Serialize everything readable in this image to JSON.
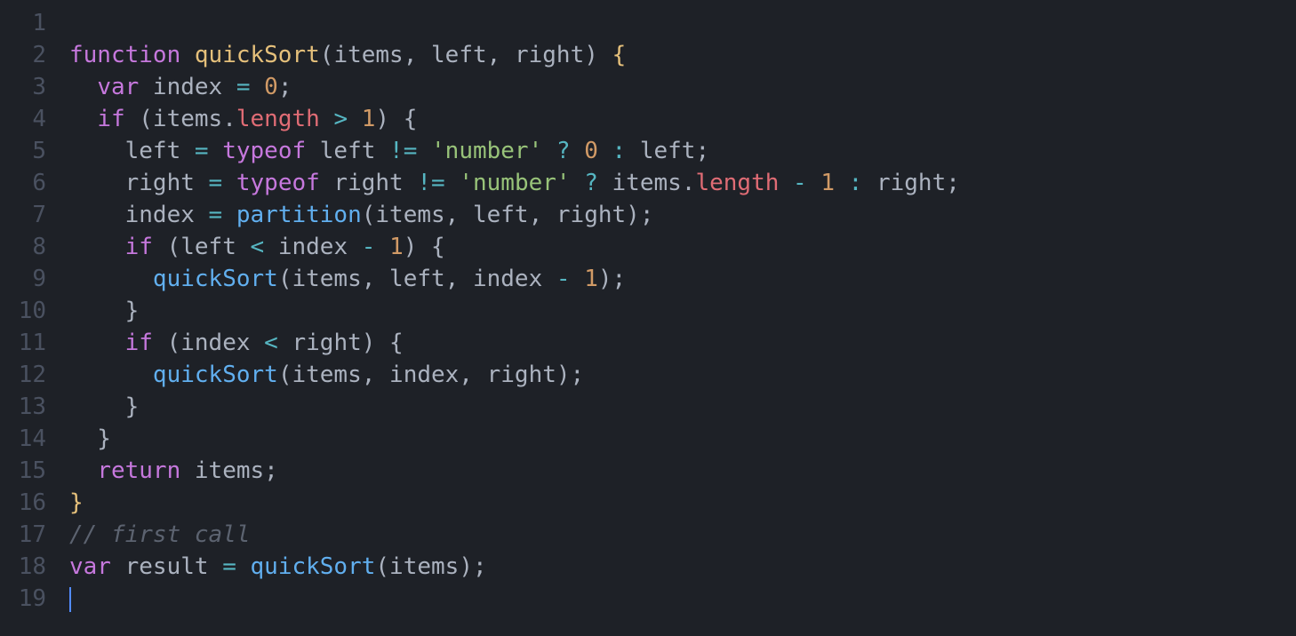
{
  "editor": {
    "language": "javascript",
    "lineNumbers": [
      "1",
      "2",
      "3",
      "4",
      "5",
      "6",
      "7",
      "8",
      "9",
      "10",
      "11",
      "12",
      "13",
      "14",
      "15",
      "16",
      "17",
      "18",
      "19"
    ],
    "cursor": {
      "line": 19,
      "column": 1
    },
    "lines": [
      {
        "tokens": []
      },
      {
        "tokens": [
          {
            "t": "kw",
            "v": "function"
          },
          {
            "t": "punc",
            "v": " "
          },
          {
            "t": "fn-decl",
            "v": "quickSort"
          },
          {
            "t": "punc",
            "v": "("
          },
          {
            "t": "param",
            "v": "items"
          },
          {
            "t": "punc",
            "v": ", "
          },
          {
            "t": "param",
            "v": "left"
          },
          {
            "t": "punc",
            "v": ", "
          },
          {
            "t": "param",
            "v": "right"
          },
          {
            "t": "punc",
            "v": ") "
          },
          {
            "t": "brace-y",
            "v": "{"
          }
        ]
      },
      {
        "tokens": [
          {
            "t": "punc",
            "v": "  "
          },
          {
            "t": "kw",
            "v": "var"
          },
          {
            "t": "punc",
            "v": " index "
          },
          {
            "t": "op",
            "v": "="
          },
          {
            "t": "punc",
            "v": " "
          },
          {
            "t": "num",
            "v": "0"
          },
          {
            "t": "punc",
            "v": ";"
          }
        ]
      },
      {
        "tokens": [
          {
            "t": "punc",
            "v": "  "
          },
          {
            "t": "kw",
            "v": "if"
          },
          {
            "t": "punc",
            "v": " (items."
          },
          {
            "t": "prop",
            "v": "length"
          },
          {
            "t": "punc",
            "v": " "
          },
          {
            "t": "op",
            "v": ">"
          },
          {
            "t": "punc",
            "v": " "
          },
          {
            "t": "num",
            "v": "1"
          },
          {
            "t": "punc",
            "v": ") {"
          }
        ]
      },
      {
        "tokens": [
          {
            "t": "punc",
            "v": "    left "
          },
          {
            "t": "op",
            "v": "="
          },
          {
            "t": "punc",
            "v": " "
          },
          {
            "t": "kw",
            "v": "typeof"
          },
          {
            "t": "punc",
            "v": " left "
          },
          {
            "t": "op",
            "v": "!="
          },
          {
            "t": "punc",
            "v": " "
          },
          {
            "t": "str",
            "v": "'number'"
          },
          {
            "t": "punc",
            "v": " "
          },
          {
            "t": "op",
            "v": "?"
          },
          {
            "t": "punc",
            "v": " "
          },
          {
            "t": "num",
            "v": "0"
          },
          {
            "t": "punc",
            "v": " "
          },
          {
            "t": "op",
            "v": ":"
          },
          {
            "t": "punc",
            "v": " left;"
          }
        ]
      },
      {
        "tokens": [
          {
            "t": "punc",
            "v": "    right "
          },
          {
            "t": "op",
            "v": "="
          },
          {
            "t": "punc",
            "v": " "
          },
          {
            "t": "kw",
            "v": "typeof"
          },
          {
            "t": "punc",
            "v": " right "
          },
          {
            "t": "op",
            "v": "!="
          },
          {
            "t": "punc",
            "v": " "
          },
          {
            "t": "str",
            "v": "'number'"
          },
          {
            "t": "punc",
            "v": " "
          },
          {
            "t": "op",
            "v": "?"
          },
          {
            "t": "punc",
            "v": " items."
          },
          {
            "t": "prop",
            "v": "length"
          },
          {
            "t": "punc",
            "v": " "
          },
          {
            "t": "op",
            "v": "-"
          },
          {
            "t": "punc",
            "v": " "
          },
          {
            "t": "num",
            "v": "1"
          },
          {
            "t": "punc",
            "v": " "
          },
          {
            "t": "op",
            "v": ":"
          },
          {
            "t": "punc",
            "v": " right;"
          }
        ]
      },
      {
        "tokens": [
          {
            "t": "punc",
            "v": "    index "
          },
          {
            "t": "op",
            "v": "="
          },
          {
            "t": "punc",
            "v": " "
          },
          {
            "t": "fn-name",
            "v": "partition"
          },
          {
            "t": "punc",
            "v": "(items, left, right);"
          }
        ]
      },
      {
        "tokens": [
          {
            "t": "punc",
            "v": "    "
          },
          {
            "t": "kw",
            "v": "if"
          },
          {
            "t": "punc",
            "v": " (left "
          },
          {
            "t": "op",
            "v": "<"
          },
          {
            "t": "punc",
            "v": " index "
          },
          {
            "t": "op",
            "v": "-"
          },
          {
            "t": "punc",
            "v": " "
          },
          {
            "t": "num",
            "v": "1"
          },
          {
            "t": "punc",
            "v": ") {"
          }
        ]
      },
      {
        "tokens": [
          {
            "t": "punc",
            "v": "      "
          },
          {
            "t": "fn-name",
            "v": "quickSort"
          },
          {
            "t": "punc",
            "v": "(items, left, index "
          },
          {
            "t": "op",
            "v": "-"
          },
          {
            "t": "punc",
            "v": " "
          },
          {
            "t": "num",
            "v": "1"
          },
          {
            "t": "punc",
            "v": ");"
          }
        ]
      },
      {
        "tokens": [
          {
            "t": "punc",
            "v": "    }"
          }
        ]
      },
      {
        "tokens": [
          {
            "t": "punc",
            "v": "    "
          },
          {
            "t": "kw",
            "v": "if"
          },
          {
            "t": "punc",
            "v": " (index "
          },
          {
            "t": "op",
            "v": "<"
          },
          {
            "t": "punc",
            "v": " right) {"
          }
        ]
      },
      {
        "tokens": [
          {
            "t": "punc",
            "v": "      "
          },
          {
            "t": "fn-name",
            "v": "quickSort"
          },
          {
            "t": "punc",
            "v": "(items, index, right);"
          }
        ]
      },
      {
        "tokens": [
          {
            "t": "punc",
            "v": "    }"
          }
        ]
      },
      {
        "tokens": [
          {
            "t": "punc",
            "v": "  }"
          }
        ]
      },
      {
        "tokens": [
          {
            "t": "punc",
            "v": "  "
          },
          {
            "t": "kw",
            "v": "return"
          },
          {
            "t": "punc",
            "v": " items;"
          }
        ]
      },
      {
        "tokens": [
          {
            "t": "brace-y",
            "v": "}"
          }
        ]
      },
      {
        "tokens": [
          {
            "t": "cmt",
            "v": "// first call"
          }
        ]
      },
      {
        "tokens": [
          {
            "t": "kw",
            "v": "var"
          },
          {
            "t": "punc",
            "v": " result "
          },
          {
            "t": "op",
            "v": "="
          },
          {
            "t": "punc",
            "v": " "
          },
          {
            "t": "fn-name",
            "v": "quickSort"
          },
          {
            "t": "punc",
            "v": "(items);"
          }
        ]
      },
      {
        "tokens": [],
        "cursor": true
      }
    ]
  }
}
